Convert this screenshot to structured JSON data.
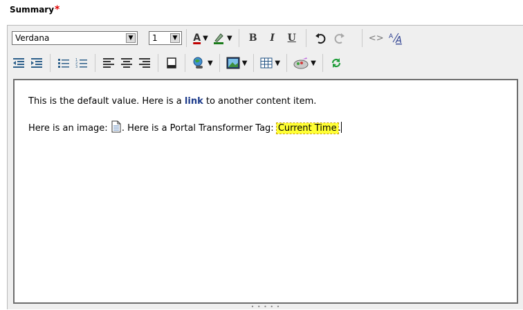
{
  "field": {
    "label": "Summary",
    "required_marker": "*"
  },
  "toolbar": {
    "font_family": "Verdana",
    "font_size": "1",
    "bold": "B",
    "italic": "I",
    "underline": "U",
    "font_color_glyph": "A",
    "spellcheck_glyph": "A"
  },
  "content": {
    "line1_before": "This is the default value.  Here is a ",
    "line1_link": "link",
    "line1_after": " to another content item.",
    "line2_before": "Here is an image: ",
    "line2_mid": ".  Here is a Portal Transformer Tag:  ",
    "line2_tag": "Current Time",
    "line2_after": "."
  },
  "icons": {
    "image_in_content": "document-icon",
    "resize": "resize-grip-icon"
  },
  "colors": {
    "required": "#e00000",
    "link": "#1c3a8a",
    "tag_highlight": "#ffff33",
    "font_color_bar": "#c00000"
  }
}
